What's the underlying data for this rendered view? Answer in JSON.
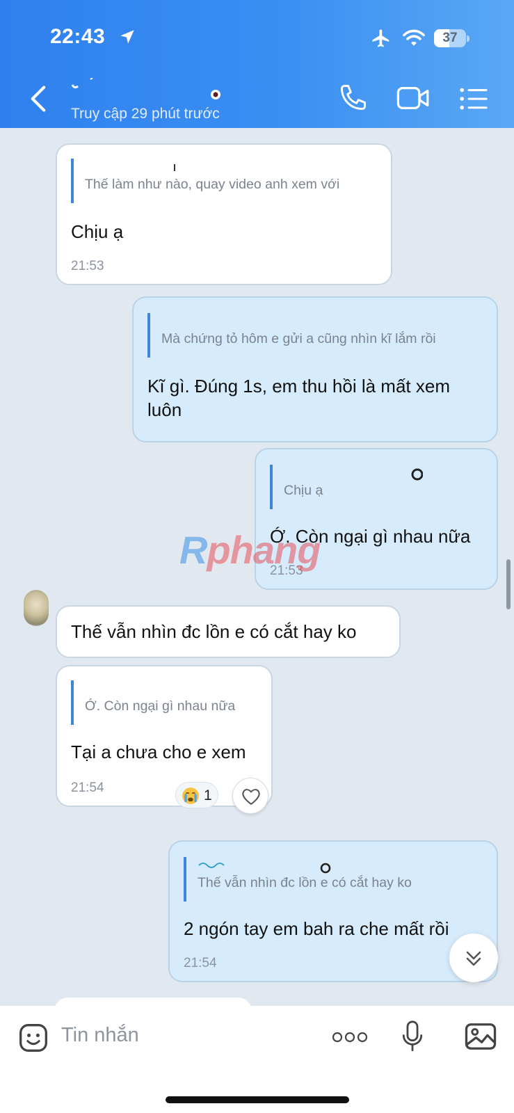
{
  "status_bar": {
    "time": "22:43",
    "battery": "37",
    "icons": [
      "location-arrow-icon",
      "airplane-icon",
      "wifi-icon",
      "battery-icon"
    ]
  },
  "header": {
    "last_seen": "Truy cập 29 phút trước",
    "icons": [
      "back-arrow-icon",
      "phone-icon",
      "video-camera-icon",
      "list-menu-icon"
    ]
  },
  "messages": [
    {
      "id": "m1",
      "direction": "incoming",
      "quote_text": "Thế làm như nào, quay video anh xem với",
      "text": "Chịu ạ",
      "time": "21:53"
    },
    {
      "id": "m2",
      "direction": "outgoing",
      "quote_text": "Mà chứng tỏ hôm e gửi a cũng nhìn kĩ lắm rồi",
      "text": "Kĩ gì. Đúng 1s, em thu hồi là mất xem luôn"
    },
    {
      "id": "m3",
      "direction": "outgoing",
      "quote_text": "Chịu ạ",
      "text": "Ớ. Còn ngại gì nhau nữa",
      "time": "21:53"
    },
    {
      "id": "m4",
      "direction": "incoming",
      "text": "Thế vẫn nhìn đc lồn e có cắt hay ko"
    },
    {
      "id": "m5",
      "direction": "incoming",
      "quote_text": "Ớ. Còn ngại gì nhau nữa",
      "text": "Tại a chưa cho e xem",
      "time": "21:54",
      "reaction": {
        "emoji": "crying-face-icon",
        "count": "1"
      }
    },
    {
      "id": "m6",
      "direction": "outgoing",
      "quote_text": "Thế vẫn nhìn đc lồn e có cắt hay ko",
      "text": "2 ngón tay em bah ra che mất rồi",
      "time": "21:54"
    }
  ],
  "watermark": {
    "brand_r": "R",
    "brand_rest": "phang"
  },
  "input_bar": {
    "placeholder": "Tin nhắn",
    "icons": [
      "sticker-icon",
      "more-dots-icon",
      "microphone-icon",
      "image-icon"
    ]
  },
  "colors": {
    "header_start": "#2f80ee",
    "header_end": "#5aa7f5",
    "chat_background": "#e2e8ef",
    "outgoing_bubble": "#d6ebfb",
    "incoming_bubble": "#ffffff",
    "quote_bar": "#3f86d6"
  }
}
